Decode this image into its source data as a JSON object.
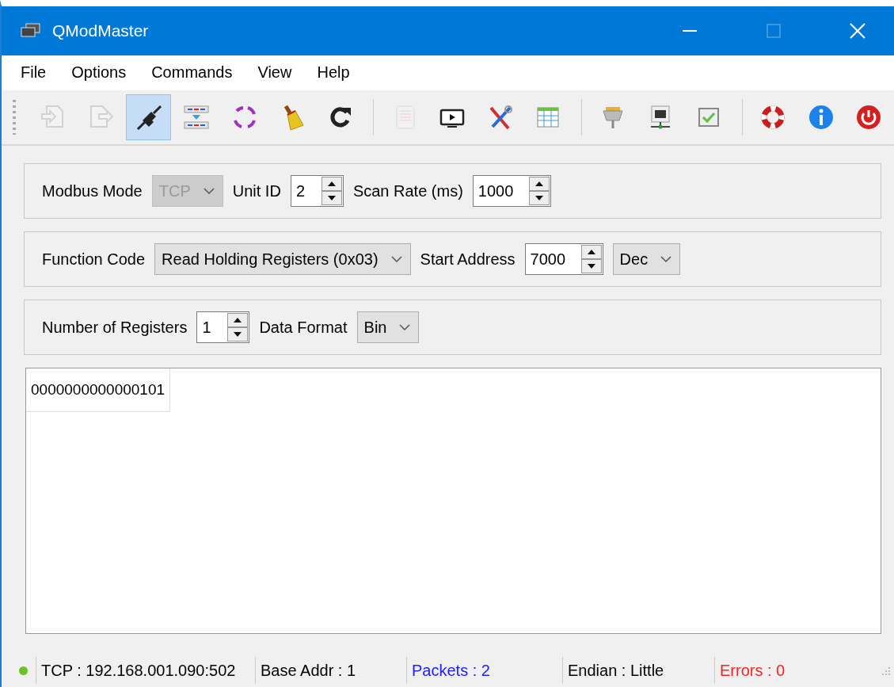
{
  "window": {
    "title": "QModMaster"
  },
  "menu": [
    "File",
    "Options",
    "Commands",
    "View",
    "Help"
  ],
  "toolbar": {
    "groups": [
      [
        {
          "disabled": true,
          "selected": false
        },
        {
          "disabled": true,
          "selected": false
        },
        {
          "disabled": false,
          "selected": true
        },
        {
          "disabled": false,
          "selected": false
        },
        {
          "disabled": false,
          "selected": false
        },
        {
          "disabled": false,
          "selected": false
        },
        {
          "disabled": false,
          "selected": false
        }
      ],
      [
        {
          "disabled": true,
          "selected": false
        },
        {
          "disabled": false,
          "selected": false
        },
        {
          "disabled": false,
          "selected": false
        },
        {
          "disabled": false,
          "selected": false
        }
      ],
      [
        {
          "disabled": false,
          "selected": false
        },
        {
          "disabled": false,
          "selected": false
        },
        {
          "disabled": false,
          "selected": false
        }
      ],
      [
        {
          "disabled": false,
          "selected": false
        },
        {
          "disabled": false,
          "selected": false
        },
        {
          "disabled": false,
          "selected": false
        }
      ]
    ]
  },
  "settings": [
    [
      {
        "kind": "label",
        "text": "Modbus Mode"
      },
      {
        "kind": "combo",
        "value": "TCP",
        "disabled": true
      },
      {
        "kind": "label",
        "text": "Unit ID"
      },
      {
        "kind": "spin",
        "value": "2"
      },
      {
        "kind": "label",
        "text": "Scan Rate (ms)"
      },
      {
        "kind": "spin",
        "value": "1000"
      }
    ],
    [
      {
        "kind": "label",
        "text": "Function Code"
      },
      {
        "kind": "combo",
        "value": "Read Holding Registers (0x03)",
        "disabled": false
      },
      {
        "kind": "label",
        "text": "Start Address"
      },
      {
        "kind": "spin",
        "value": "7000"
      },
      {
        "kind": "combo",
        "value": "Dec",
        "disabled": false
      }
    ],
    [
      {
        "kind": "label",
        "text": "Number of Registers"
      },
      {
        "kind": "spin",
        "value": "1"
      },
      {
        "kind": "label",
        "text": "Data Format"
      },
      {
        "kind": "combo",
        "value": "Bin",
        "disabled": false
      }
    ]
  ],
  "grid": {
    "cells": [
      "0000000000000101"
    ]
  },
  "status_bar": {
    "items": [
      {
        "kind": "indicator",
        "color": "#6fc02a"
      },
      {
        "kind": "text",
        "text": "TCP : 192.168.001.090:502",
        "color": "#000000"
      },
      {
        "kind": "text",
        "text": "Base Addr : 1",
        "color": "#000000"
      },
      {
        "kind": "text",
        "text": "Packets : 2",
        "color": "#2020ff"
      },
      {
        "kind": "text",
        "text": "Endian : Little",
        "color": "#000000"
      },
      {
        "kind": "text",
        "text": "Errors : 0",
        "color": "#ff2020"
      }
    ]
  }
}
